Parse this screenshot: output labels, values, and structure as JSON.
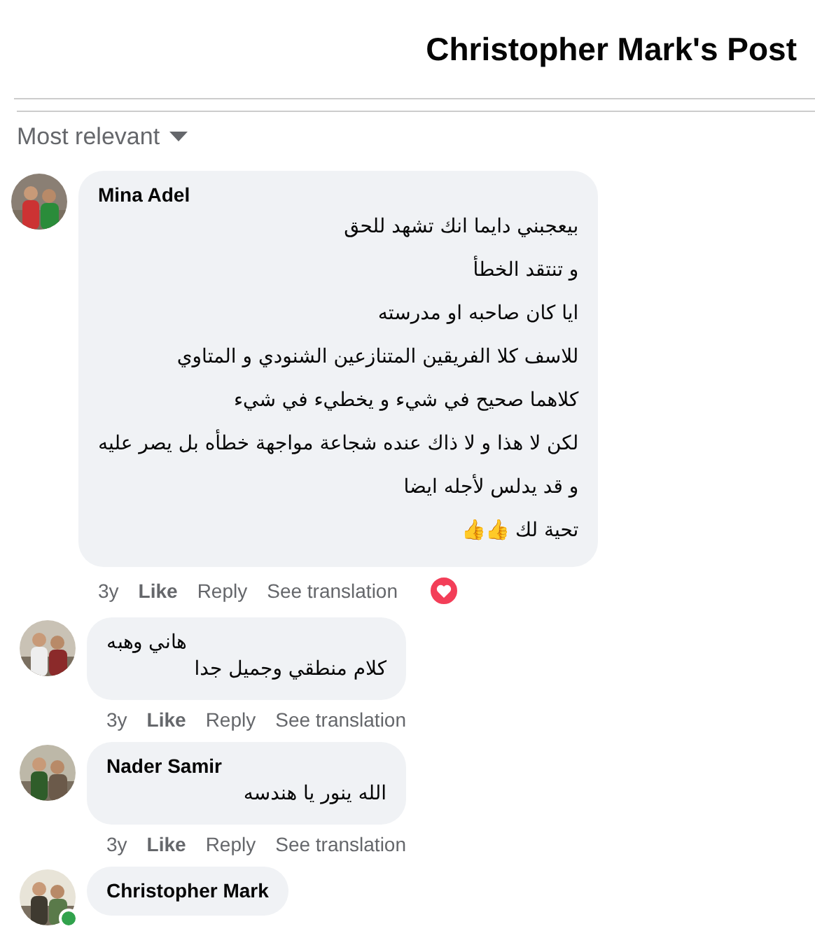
{
  "header": {
    "title": "Christopher Mark's Post"
  },
  "sort": {
    "label": "Most relevant"
  },
  "comments": [
    {
      "author": "Mina Adel",
      "online": false,
      "lines": [
        "بيعجبني دايما انك تشهد للحق",
        "و تنتقد الخطأ",
        "ايا كان صاحبه او مدرسته",
        "للاسف كلا الفريقين المتنازعين الشنودي و المتاوي",
        "كلاهما صحيح في شيء و يخطيء في شيء",
        "لكن لا هذا و لا ذاك عنده شجاعة مواجهة خطأه بل يصر عليه",
        "و قد يدلس لأجله ايضا",
        "تحية لك 👍👍"
      ],
      "time": "3y",
      "like": "Like",
      "reply": "Reply",
      "translate": "See translation",
      "reactions": [
        {
          "kind": "heart"
        }
      ]
    },
    {
      "author": "هاني وهبه",
      "online": false,
      "lines": [
        "كلام منطقي وجميل جدا"
      ],
      "time": "3y",
      "like": "Like",
      "reply": "Reply",
      "translate": "See translation"
    },
    {
      "author": "Nader Samir",
      "online": false,
      "lines": [
        "الله ينور يا هندسه"
      ],
      "time": "3y",
      "like": "Like",
      "reply": "Reply",
      "translate": "See translation"
    },
    {
      "author": "Christopher Mark",
      "online": true
    }
  ]
}
